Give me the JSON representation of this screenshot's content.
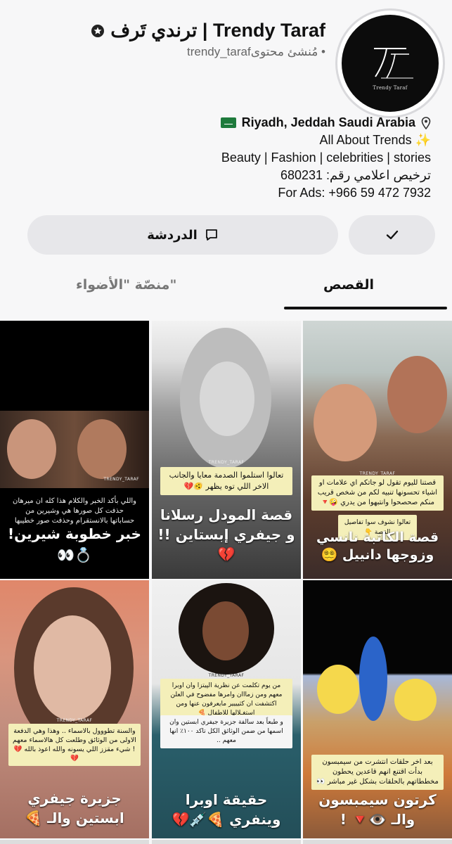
{
  "profile": {
    "display_name": "ترندي تَرف | Trendy Taraf",
    "handle": "trendy_taraf",
    "role": "مُنشئ محتوى •",
    "logo_text": "Trendy Taraf",
    "logo_letters": "TT",
    "bio": {
      "location": "Riyadh, Jeddah Saudi Arabia",
      "tagline": "All About Trends ✨",
      "categories": "Beauty  | Fashion | celebrities | stories",
      "license": "ترخيص اعلامي رقم: 680231",
      "ads": "For Ads: +966 59 472 7932"
    }
  },
  "actions": {
    "chat_label": "الدردشة"
  },
  "tabs": {
    "stories": "القصص",
    "spotlight": "منصّة \"الأضواء\""
  },
  "tiles": [
    {
      "note": "قصتنا لليوم تقول لو جاتكم اي علامات او اشياء تحسونها تنبيه لكم من شخص قريب منكم صحصحوا وانتبهوا من يدري 🤪🔻",
      "note2": "تعالوا نشوف سوا تفاصيل القصة 👇",
      "caption": "قصة الكاتبة نانسي وزوجها دانييل 😵‍💫",
      "watermark": "TRENDY_TARAF"
    },
    {
      "note": "تعالوا استلموا الصدمة معايا والجانب الاخر اللي توه يظهر 🫨💔",
      "caption": "قصة المودل رسلانا و جيفري إبستاين !! 💔",
      "watermark": "TRENDY_TARAF"
    },
    {
      "note": "واللي بأكد الخبر والكلام هذا كله ان ميرهان حذفت كل صورها هي وشيرين من حساباتها بالانستقرام وحذفت صور خطيبها",
      "caption": "خبر خطوبة شيرين! 💍👀",
      "watermark": "TRENDY_TARAF"
    },
    {
      "note": "بعد اخر حلقات انتشرت من سيمبسون بدأت اقتنع انهم قاعدين يحطون مخططاتهم بالحلقات بشكل غير مباشر 👀",
      "caption": "كرتون سيمبسون والـ 👁️🔻 !",
      "watermark": ""
    },
    {
      "note": "من يوم تكلمت عن نظرية الپيتزا وان اوبرا معهم ومن زمااان وامرها مفضوح في العلن اكتشفت ان كثيييير مايعرفون عنها ومن استغـلالها للاطفال 🍕",
      "note2": "و طبعاً بعد سالفة جزيرة جيفري ابستين وان اسمها من ضمن الوثائق الكل تاكد ١٠٠٪ انها معهم ..",
      "caption": "حقيقة اوبرا وينفري 🍕💉💔",
      "watermark": "TRENDY_TARAF"
    },
    {
      "note": "والسنة تطووول بالاسماء .. وهذا وهي الدفعة الاولى من الوثائق وطلعت كل هالاسماء معهم ! شيء مقزز اللي يسونه والله اعوذ بالله 💔💔",
      "caption": "جزيرة جيفري ابستين والـ 🍕",
      "watermark": "TRENDY_TARAF"
    }
  ]
}
